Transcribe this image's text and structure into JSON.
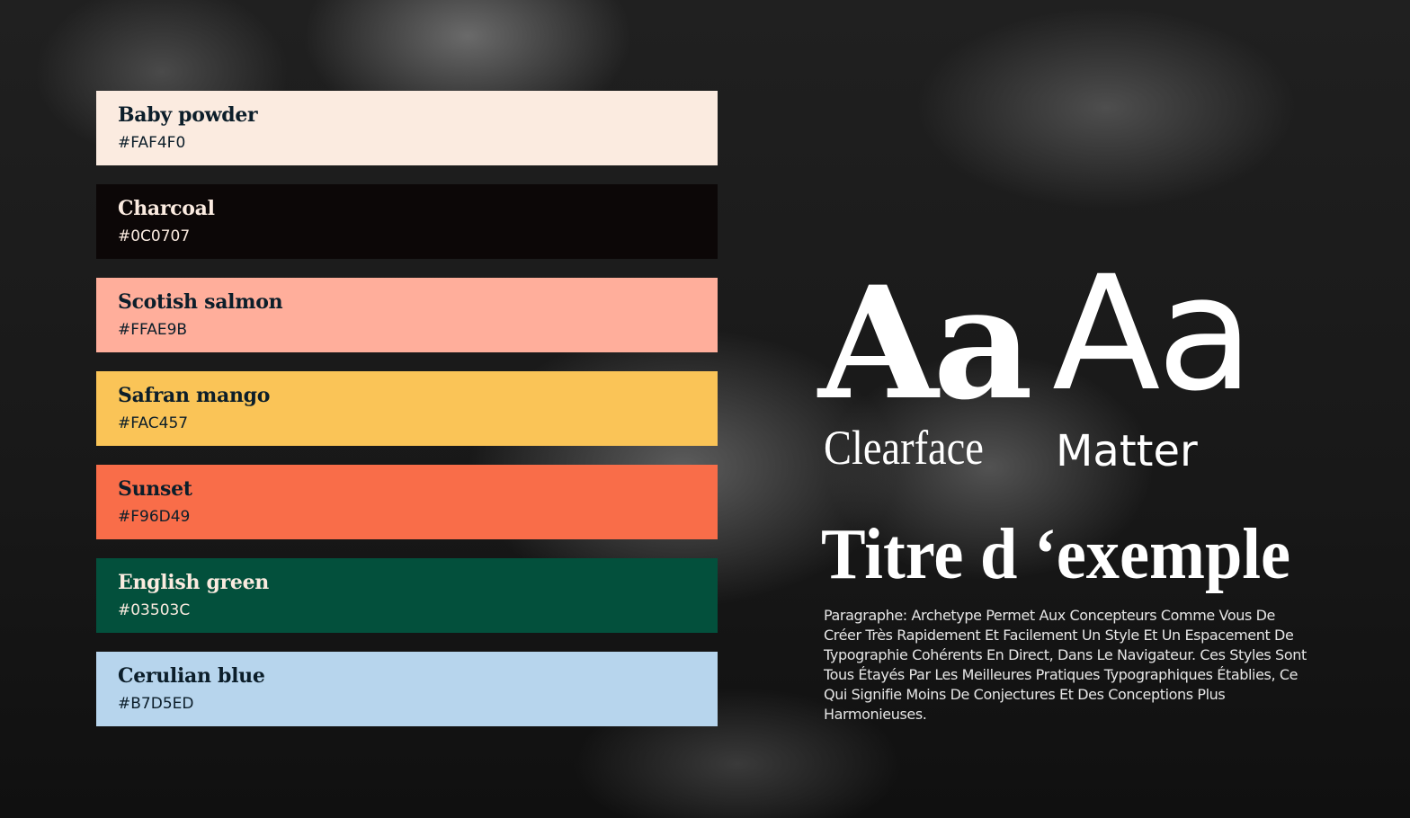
{
  "palette": [
    {
      "name": "Baby powder",
      "hex": "#FAF4F0",
      "fill": "#FBEBE0",
      "text": "#0C1E2A"
    },
    {
      "name": "Charcoal",
      "hex": "#0C0707",
      "fill": "#0C0707",
      "text": "#FBEBE0"
    },
    {
      "name": "Scotish salmon",
      "hex": "#FFAE9B",
      "fill": "#FFAE9B",
      "text": "#0C1E2A"
    },
    {
      "name": "Safran mango",
      "hex": "#FAC457",
      "fill": "#FAC457",
      "text": "#0C1E2A"
    },
    {
      "name": "Sunset",
      "hex": "#F96D49",
      "fill": "#F96D49",
      "text": "#0C1E2A"
    },
    {
      "name": "English green",
      "hex": "#03503C",
      "fill": "#03503C",
      "text": "#FBEBE0"
    },
    {
      "name": "Cerulian blue",
      "hex": "#B7D5ED",
      "fill": "#B7D5ED",
      "text": "#0C1E2A"
    }
  ],
  "typography": {
    "sample_glyphs": "Aa",
    "serif_font_label": "Clearface",
    "sans_font_label": "Matter",
    "title": "Titre d ‘exemple",
    "paragraph": "Paragraphe: Archetype Permet Aux Concepteurs Comme Vous De Créer Très Rapidement Et Facilement Un Style Et Un Espacement De Typographie Cohérents En Direct, Dans Le Navigateur. Ces Styles Sont Tous Étayés Par Les Meilleures Pratiques Typographiques Établies, Ce Qui Signifie Moins De Conjectures Et Des Conceptions Plus Harmonieuses."
  }
}
